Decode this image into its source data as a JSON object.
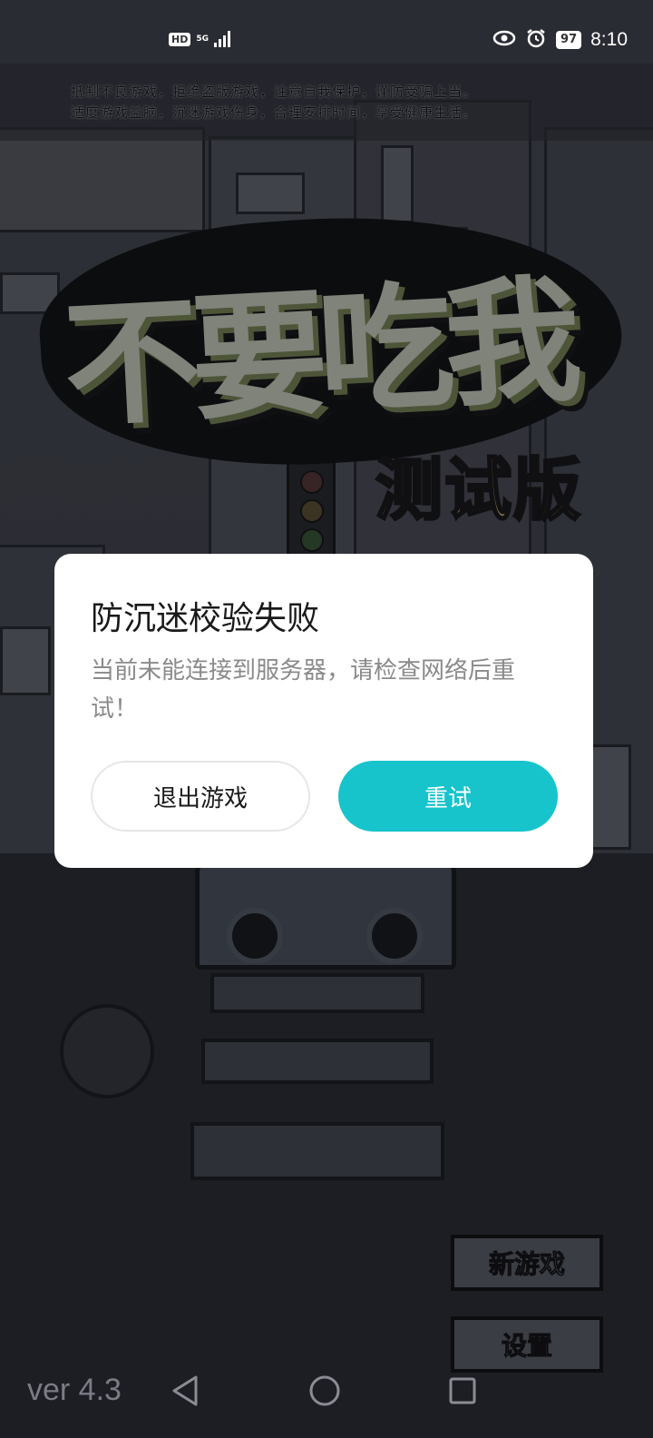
{
  "status_bar": {
    "hd": "HD",
    "network": "5G",
    "battery": "97",
    "time": "8:10",
    "icons": [
      "hd-icon",
      "signal-icon",
      "eye-comfort-icon",
      "alarm-icon",
      "battery-icon"
    ]
  },
  "health_notice": {
    "line1": "抵制不良游戏，拒绝盗版游戏，注意自我保护，谨防受骗上当。",
    "line2": "适度游戏益脑，沉迷游戏伤身，合理安排时间，享受健康生活。"
  },
  "logo": {
    "title": "不要吃我",
    "subtitle": "测试版"
  },
  "menu": {
    "new_game": "新游戏",
    "settings": "设置"
  },
  "version": "ver 4.3",
  "dialog": {
    "title": "防沉迷校验失败",
    "message": "当前未能连接到服务器，请检查网络后重试！",
    "exit_label": "退出游戏",
    "retry_label": "重试",
    "retry_color": "#17c4cc"
  },
  "nav": {
    "icons": [
      "back-icon",
      "home-icon",
      "recents-icon"
    ]
  }
}
